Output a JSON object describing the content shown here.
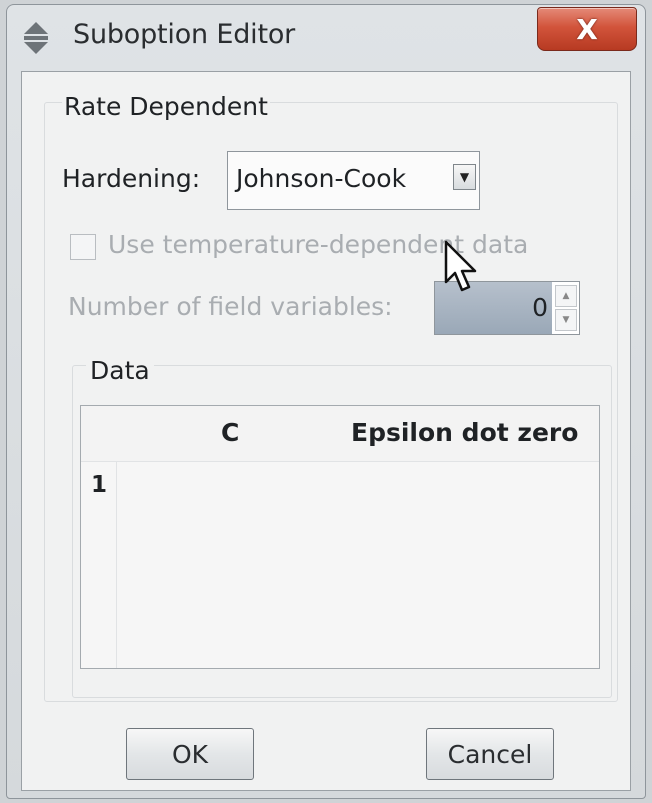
{
  "window": {
    "title": "Suboption Editor",
    "close_label": "X"
  },
  "group": {
    "title": "Rate Dependent"
  },
  "hardening": {
    "label": "Hardening:",
    "value": "Johnson-Cook"
  },
  "temperature": {
    "label": "Use temperature-dependent data",
    "checked": false
  },
  "field_variables": {
    "label": "Number of field variables:",
    "value": "0"
  },
  "data": {
    "title": "Data",
    "columns": [
      "C",
      "Epsilon dot zero"
    ],
    "rows": [
      {
        "index": "1",
        "cells": [
          "",
          ""
        ]
      }
    ]
  },
  "buttons": {
    "ok": "OK",
    "cancel": "Cancel"
  },
  "colors": {
    "close_button": "#d2543b",
    "spin_field": "#9aa8b7",
    "disabled_text": "#a9adb1"
  },
  "icons": [
    "app-icon",
    "close-icon",
    "chevron-down-icon",
    "spin-up-icon",
    "spin-down-icon",
    "mouse-cursor-icon"
  ]
}
